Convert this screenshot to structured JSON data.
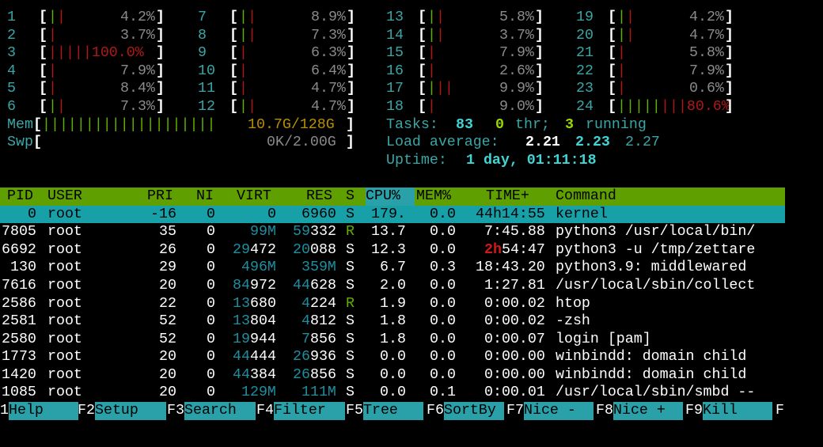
{
  "cpus": [
    {
      "id": "1",
      "pct": "4.2%",
      "bars": [
        [
          "g",
          "|"
        ],
        [
          "r",
          "|"
        ]
      ]
    },
    {
      "id": "2",
      "pct": "3.7%",
      "bars": [
        [
          "r",
          "|"
        ]
      ]
    },
    {
      "id": "3",
      "pct": "100.0%",
      "bars": [
        [
          "r",
          "|||||100.0%"
        ]
      ]
    },
    {
      "id": "4",
      "pct": "7.9%",
      "bars": [
        [
          "r",
          "|"
        ]
      ]
    },
    {
      "id": "5",
      "pct": "8.4%",
      "bars": [
        [
          "r",
          "|"
        ]
      ]
    },
    {
      "id": "6",
      "pct": "7.3%",
      "bars": [
        [
          "g",
          "|"
        ],
        [
          "r",
          "|"
        ]
      ]
    },
    {
      "id": "7",
      "pct": "8.9%",
      "bars": [
        [
          "g",
          "|"
        ],
        [
          "r",
          "|"
        ]
      ]
    },
    {
      "id": "8",
      "pct": "7.3%",
      "bars": [
        [
          "g",
          "|"
        ],
        [
          "r",
          "|"
        ]
      ]
    },
    {
      "id": "9",
      "pct": "6.3%",
      "bars": [
        [
          "r",
          "|"
        ]
      ]
    },
    {
      "id": "10",
      "pct": "6.4%",
      "bars": [
        [
          "r",
          "|"
        ]
      ]
    },
    {
      "id": "11",
      "pct": "4.7%",
      "bars": [
        [
          "r",
          "|"
        ]
      ]
    },
    {
      "id": "12",
      "pct": "4.7%",
      "bars": [
        [
          "g",
          "|"
        ],
        [
          "r",
          "|"
        ]
      ]
    },
    {
      "id": "13",
      "pct": "5.8%",
      "bars": [
        [
          "g",
          "|"
        ],
        [
          "r",
          "|"
        ]
      ]
    },
    {
      "id": "14",
      "pct": "3.7%",
      "bars": [
        [
          "g",
          "|"
        ],
        [
          "r",
          "|"
        ]
      ]
    },
    {
      "id": "15",
      "pct": "7.9%",
      "bars": [
        [
          "r",
          "|"
        ]
      ]
    },
    {
      "id": "16",
      "pct": "2.6%",
      "bars": [
        [
          "r",
          "|"
        ]
      ]
    },
    {
      "id": "17",
      "pct": "9.9%",
      "bars": [
        [
          "g",
          "|"
        ],
        [
          "r",
          "||"
        ]
      ]
    },
    {
      "id": "18",
      "pct": "9.0%",
      "bars": [
        [
          "r",
          "|"
        ]
      ]
    },
    {
      "id": "19",
      "pct": "4.2%",
      "bars": [
        [
          "g",
          "|"
        ],
        [
          "r",
          "|"
        ]
      ]
    },
    {
      "id": "20",
      "pct": "4.7%",
      "bars": [
        [
          "g",
          "|"
        ],
        [
          "r",
          "|"
        ]
      ]
    },
    {
      "id": "21",
      "pct": "5.8%",
      "bars": [
        [
          "r",
          "|"
        ]
      ]
    },
    {
      "id": "22",
      "pct": "7.9%",
      "bars": [
        [
          "r",
          "|"
        ]
      ]
    },
    {
      "id": "23",
      "pct": "0.6%",
      "bars": [
        [
          "r",
          "|"
        ]
      ]
    },
    {
      "id": "24",
      "pct": "80.6%",
      "bars": [
        [
          "g",
          "|||||"
        ],
        [
          "r",
          "|||80.6%"
        ]
      ]
    }
  ],
  "mem": {
    "label": "Mem",
    "bar": "||||||||||||||||||||",
    "value": "10.7G/128G"
  },
  "swp": {
    "label": "Swp",
    "value": "0K/2.00G"
  },
  "tasks": {
    "label": "Tasks:",
    "count": "83",
    "thr": "0",
    "thr_label": "thr;",
    "running": "3",
    "running_label": "running"
  },
  "load": {
    "label": "Load average:",
    "l1": "2.21",
    "l5": "2.23",
    "l15": "2.27"
  },
  "uptime": {
    "label": "Uptime:",
    "value": "1 day, 01:11:18"
  },
  "table": {
    "headers": {
      "pid": "PID",
      "user": "USER",
      "pri": "PRI",
      "ni": "NI",
      "virt": "VIRT",
      "res": "RES",
      "s": "S",
      "cpu": "CPU%",
      "mem": "MEM%",
      "time": "TIME+",
      "cmd": "Command"
    },
    "rows": [
      {
        "pid": "0",
        "user": "root",
        "pri": "-16",
        "ni": "0",
        "virt": "0",
        "res": "6960",
        "s": "S",
        "cpu": "179.",
        "mem": "0.0",
        "time": "44h14:55",
        "cmd": "kernel",
        "selected": true
      },
      {
        "pid": "7805",
        "user": "root",
        "pri": "35",
        "ni": "0",
        "virt": "99M",
        "res": "59332",
        "s": "R",
        "cpu": "13.7",
        "mem": "0.0",
        "time": "7:45.88",
        "cmd": "python3 /usr/local/bin/"
      },
      {
        "pid": "6692",
        "user": "root",
        "pri": "26",
        "ni": "0",
        "virt": "29472",
        "res": "20088",
        "s": "S",
        "cpu": "12.3",
        "mem": "0.0",
        "time": "2h54:47",
        "cmd": "python3 -u /tmp/zettare"
      },
      {
        "pid": "130",
        "user": "root",
        "pri": "29",
        "ni": "0",
        "virt": "496M",
        "res": "359M",
        "s": "S",
        "cpu": "6.7",
        "mem": "0.3",
        "time": "18:43.20",
        "cmd": "python3.9: middlewared"
      },
      {
        "pid": "7616",
        "user": "root",
        "pri": "20",
        "ni": "0",
        "virt": "84972",
        "res": "44628",
        "s": "S",
        "cpu": "2.0",
        "mem": "0.0",
        "time": "1:27.81",
        "cmd": "/usr/local/sbin/collect"
      },
      {
        "pid": "2586",
        "user": "root",
        "pri": "22",
        "ni": "0",
        "virt": "13680",
        "res": "4224",
        "s": "R",
        "cpu": "1.9",
        "mem": "0.0",
        "time": "0:00.02",
        "cmd": "htop"
      },
      {
        "pid": "2581",
        "user": "root",
        "pri": "52",
        "ni": "0",
        "virt": "13804",
        "res": "4812",
        "s": "S",
        "cpu": "1.8",
        "mem": "0.0",
        "time": "0:00.02",
        "cmd": "-zsh"
      },
      {
        "pid": "2580",
        "user": "root",
        "pri": "52",
        "ni": "0",
        "virt": "19944",
        "res": "7856",
        "s": "S",
        "cpu": "1.8",
        "mem": "0.0",
        "time": "0:00.07",
        "cmd": "login [pam]"
      },
      {
        "pid": "1773",
        "user": "root",
        "pri": "20",
        "ni": "0",
        "virt": "44444",
        "res": "26936",
        "s": "S",
        "cpu": "0.0",
        "mem": "0.0",
        "time": "0:00.00",
        "cmd": "winbindd: domain child"
      },
      {
        "pid": "1420",
        "user": "root",
        "pri": "20",
        "ni": "0",
        "virt": "44384",
        "res": "26856",
        "s": "S",
        "cpu": "0.0",
        "mem": "0.0",
        "time": "0:00.00",
        "cmd": "winbindd: domain child"
      },
      {
        "pid": "1085",
        "user": "root",
        "pri": "20",
        "ni": "0",
        "virt": "129M",
        "res": "111M",
        "s": "S",
        "cpu": "0.0",
        "mem": "0.1",
        "time": "0:00.01",
        "cmd": "/usr/local/sbin/smbd --"
      }
    ]
  },
  "fkeys": [
    {
      "key": "1",
      "label": "Help"
    },
    {
      "key": "F2",
      "label": "Setup"
    },
    {
      "key": "F3",
      "label": "Search"
    },
    {
      "key": "F4",
      "label": "Filter"
    },
    {
      "key": "F5",
      "label": "Tree"
    },
    {
      "key": "F6",
      "label": "SortBy"
    },
    {
      "key": "F7",
      "label": "Nice -"
    },
    {
      "key": "F8",
      "label": "Nice +"
    },
    {
      "key": "F9",
      "label": "Kill"
    },
    {
      "key": "F",
      "label": ""
    }
  ],
  "colors": {
    "header_bg": "#5fa000",
    "selected_bg": "#17a0a8",
    "fbtn_bg": "#2aa0a8",
    "accent_cyan": "#40d4d4"
  }
}
